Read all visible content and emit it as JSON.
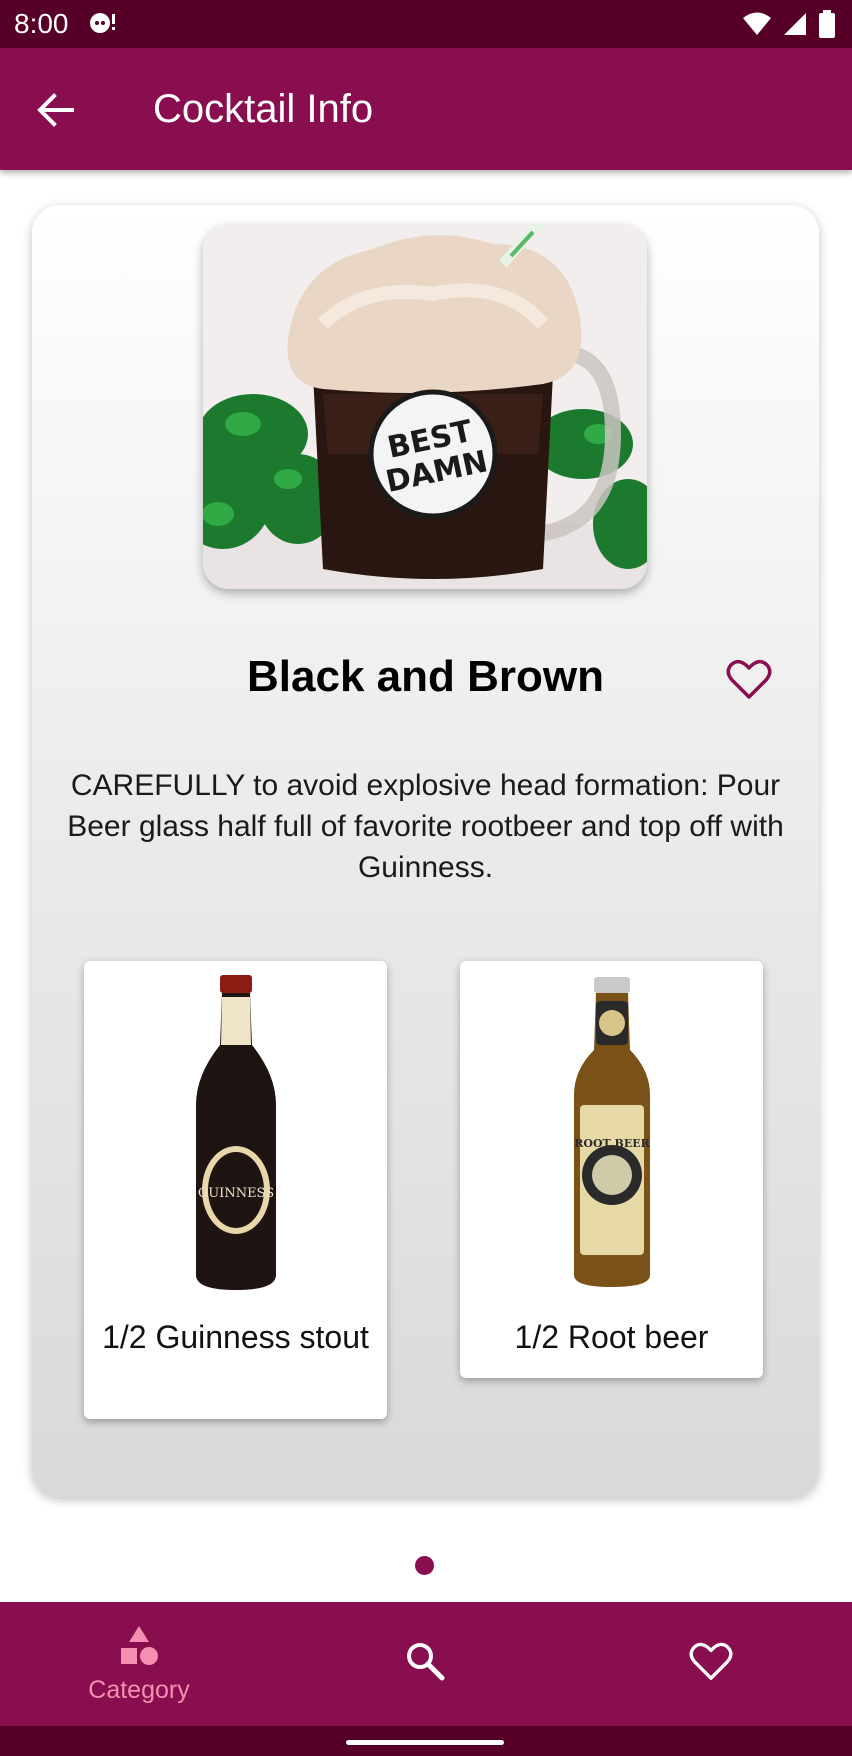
{
  "status_bar": {
    "time": "8:00",
    "icons": [
      "notification-icon",
      "wifi-icon",
      "signal-icon",
      "battery-icon"
    ]
  },
  "app_bar": {
    "title": "Cocktail Info",
    "back_icon": "arrow-back-icon"
  },
  "cocktail": {
    "name": "Black and Brown",
    "favorite_icon": "heart-outline-icon",
    "image_logo_text": [
      "BEST",
      "DAMN"
    ],
    "instructions": "CAREFULLY to avoid explosive head formation: Pour Beer glass half full of favorite rootbeer and top off with Guinness.",
    "ingredients": [
      {
        "measure": "1/2",
        "name": "Guinness stout",
        "label": "1/2  Guinness stout",
        "bottle_text": "GUINNESS"
      },
      {
        "measure": "1/2",
        "name": "Root beer",
        "label": "1/2  Root beer",
        "bottle_text": "ROOT BEER"
      }
    ]
  },
  "pager": {
    "current": 1,
    "total": 1
  },
  "bottom_nav": {
    "items": [
      {
        "label": "Category",
        "icon": "category-icon",
        "selected": true
      },
      {
        "label": "",
        "icon": "search-icon",
        "selected": false
      },
      {
        "label": "",
        "icon": "heart-icon",
        "selected": false
      }
    ]
  },
  "colors": {
    "primary": "#880e4f",
    "primary_dark": "#560027",
    "accent": "#f48fb1",
    "background": "#ffffff"
  }
}
